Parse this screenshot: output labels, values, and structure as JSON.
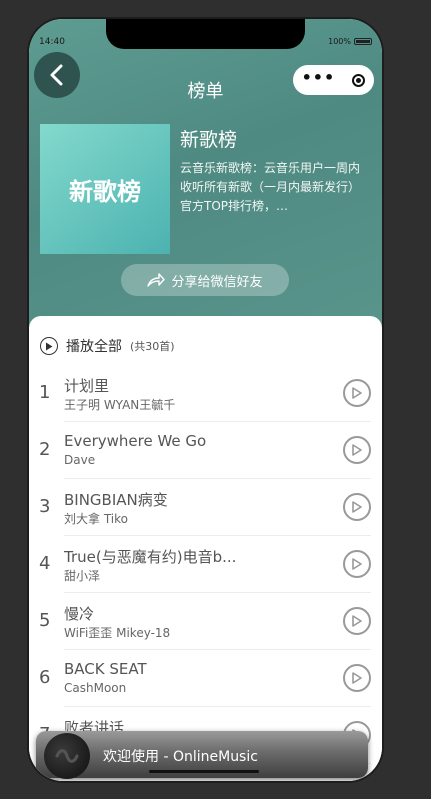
{
  "status": {
    "time": "14:40",
    "battery": "100%"
  },
  "header": {
    "title": "榜单"
  },
  "playlist": {
    "cover_text": "新歌榜",
    "name": "新歌榜",
    "description": "云音乐新歌榜：云音乐用户一周内收听所有新歌（一月内最新发行） 官方TOP排行榜，…",
    "share_label": "分享给微信好友"
  },
  "play_all": {
    "label": "播放全部",
    "count": "(共30首)"
  },
  "songs": [
    {
      "num": "1",
      "title": "计划里",
      "artist": "王子明 WYAN王毓千"
    },
    {
      "num": "2",
      "title": "Everywhere We Go",
      "artist": "Dave"
    },
    {
      "num": "3",
      "title": "BINGBIAN病变",
      "artist": "刘大拿 Tiko"
    },
    {
      "num": "4",
      "title": "True(与恶魔有约)电音b...",
      "artist": "甜小泽"
    },
    {
      "num": "5",
      "title": "慢冷",
      "artist": "WiFi歪歪 Mikey-18"
    },
    {
      "num": "6",
      "title": "BACK SEAT",
      "artist": "CashMoon"
    },
    {
      "num": "7",
      "title": "败者讲话",
      "artist": ""
    }
  ],
  "player": {
    "text": "欢迎使用 - OnlineMusic"
  },
  "colors": {
    "hero": "#5e9c92",
    "cover": "#4cb2b0",
    "background": "#2f2f2f"
  },
  "icons": {
    "back": "chevron-left-icon",
    "more": "more-dots-icon",
    "close": "record-icon",
    "share": "share-arrow-icon",
    "play": "play-circle-icon"
  }
}
